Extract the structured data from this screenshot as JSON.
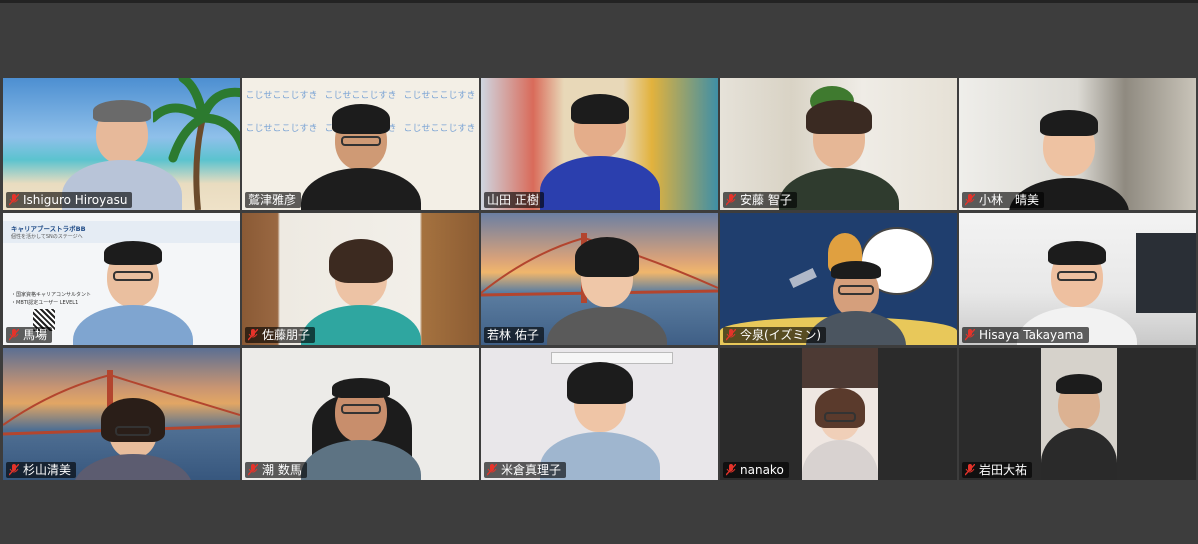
{
  "colors": {
    "background": "#3d3d3d",
    "active_speaker_border": "#2fd075",
    "muted_icon": "#e5332a",
    "label_bg": "rgba(0,0,0,0.62)"
  },
  "participants": [
    {
      "name": "Ishiguro Hiroyasu",
      "muted": true,
      "active": false
    },
    {
      "name": "鷲津雅彦",
      "muted": false,
      "active": true
    },
    {
      "name": "山田 正樹",
      "muted": false,
      "active": false
    },
    {
      "name": "安藤 智子",
      "muted": true,
      "active": false
    },
    {
      "name": "小林　晴美",
      "muted": true,
      "active": false
    },
    {
      "name": "馬場",
      "muted": true,
      "active": false
    },
    {
      "name": "佐藤朋子",
      "muted": true,
      "active": false
    },
    {
      "name": "若林 佑子",
      "muted": false,
      "active": false
    },
    {
      "name": "今泉(イズミン)",
      "muted": true,
      "active": false
    },
    {
      "name": "Hisaya Takayama",
      "muted": true,
      "active": false
    },
    {
      "name": "杉山清美",
      "muted": true,
      "active": false
    },
    {
      "name": "潮 数馬",
      "muted": true,
      "active": false
    },
    {
      "name": "米倉真理子",
      "muted": true,
      "active": false
    },
    {
      "name": "nanako",
      "muted": true,
      "active": false
    },
    {
      "name": "岩田大祐",
      "muted": true,
      "active": false
    }
  ],
  "backgrounds": {
    "banner_text": "こじせここじすき",
    "slide_title": "キャリアブーストラボBB",
    "slide_subtitle": "個性を活かしてSNのステージへ",
    "slide_line1": "・国家資格キャリアコンサルタント",
    "slide_line2": "・MBTI認定ユーザー LEVEL1"
  }
}
